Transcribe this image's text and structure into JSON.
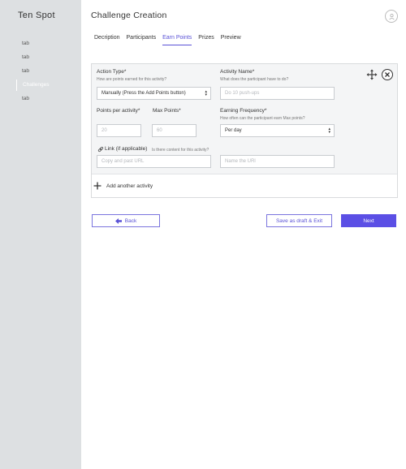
{
  "sidebar": {
    "brand": "Ten Spot",
    "items": [
      {
        "label": "tab"
      },
      {
        "label": "tab"
      },
      {
        "label": "tab"
      },
      {
        "label": "Challenges"
      },
      {
        "label": "tab"
      }
    ]
  },
  "header": {
    "title": "Challenge Creation"
  },
  "tabs": [
    {
      "label": "Decription"
    },
    {
      "label": "Participants"
    },
    {
      "label": "Earn Points"
    },
    {
      "label": "Prizes"
    },
    {
      "label": "Preview"
    }
  ],
  "form": {
    "action_type": {
      "label": "Action Type*",
      "hint": "How are points earned for this activity?",
      "value": "Manually (Press the Add Points button)"
    },
    "activity_name": {
      "label": "Activity Name*",
      "hint": "What does the participant have to do?",
      "placeholder": "Do 10 push-ups"
    },
    "points_per_activity": {
      "label": "Points per activity*",
      "placeholder": "20"
    },
    "max_points": {
      "label": "Max Points*",
      "placeholder": "60"
    },
    "earning_frequency": {
      "label": "Earning Frequency*",
      "hint": "How often can the participant earn Max points?",
      "value": "Per day"
    },
    "link": {
      "label": "Link (if applicable)",
      "hint": "Is there content for this activity?",
      "url_placeholder": "Copy and past URL",
      "name_placeholder": "Name the URl"
    }
  },
  "add_activity": {
    "label": "Add another activity"
  },
  "buttons": {
    "back": "Back",
    "draft": "Save as draft & Exit",
    "next": "Next"
  },
  "colors": {
    "accent": "#5b4fe5",
    "sidebar": "#dde0e2"
  }
}
